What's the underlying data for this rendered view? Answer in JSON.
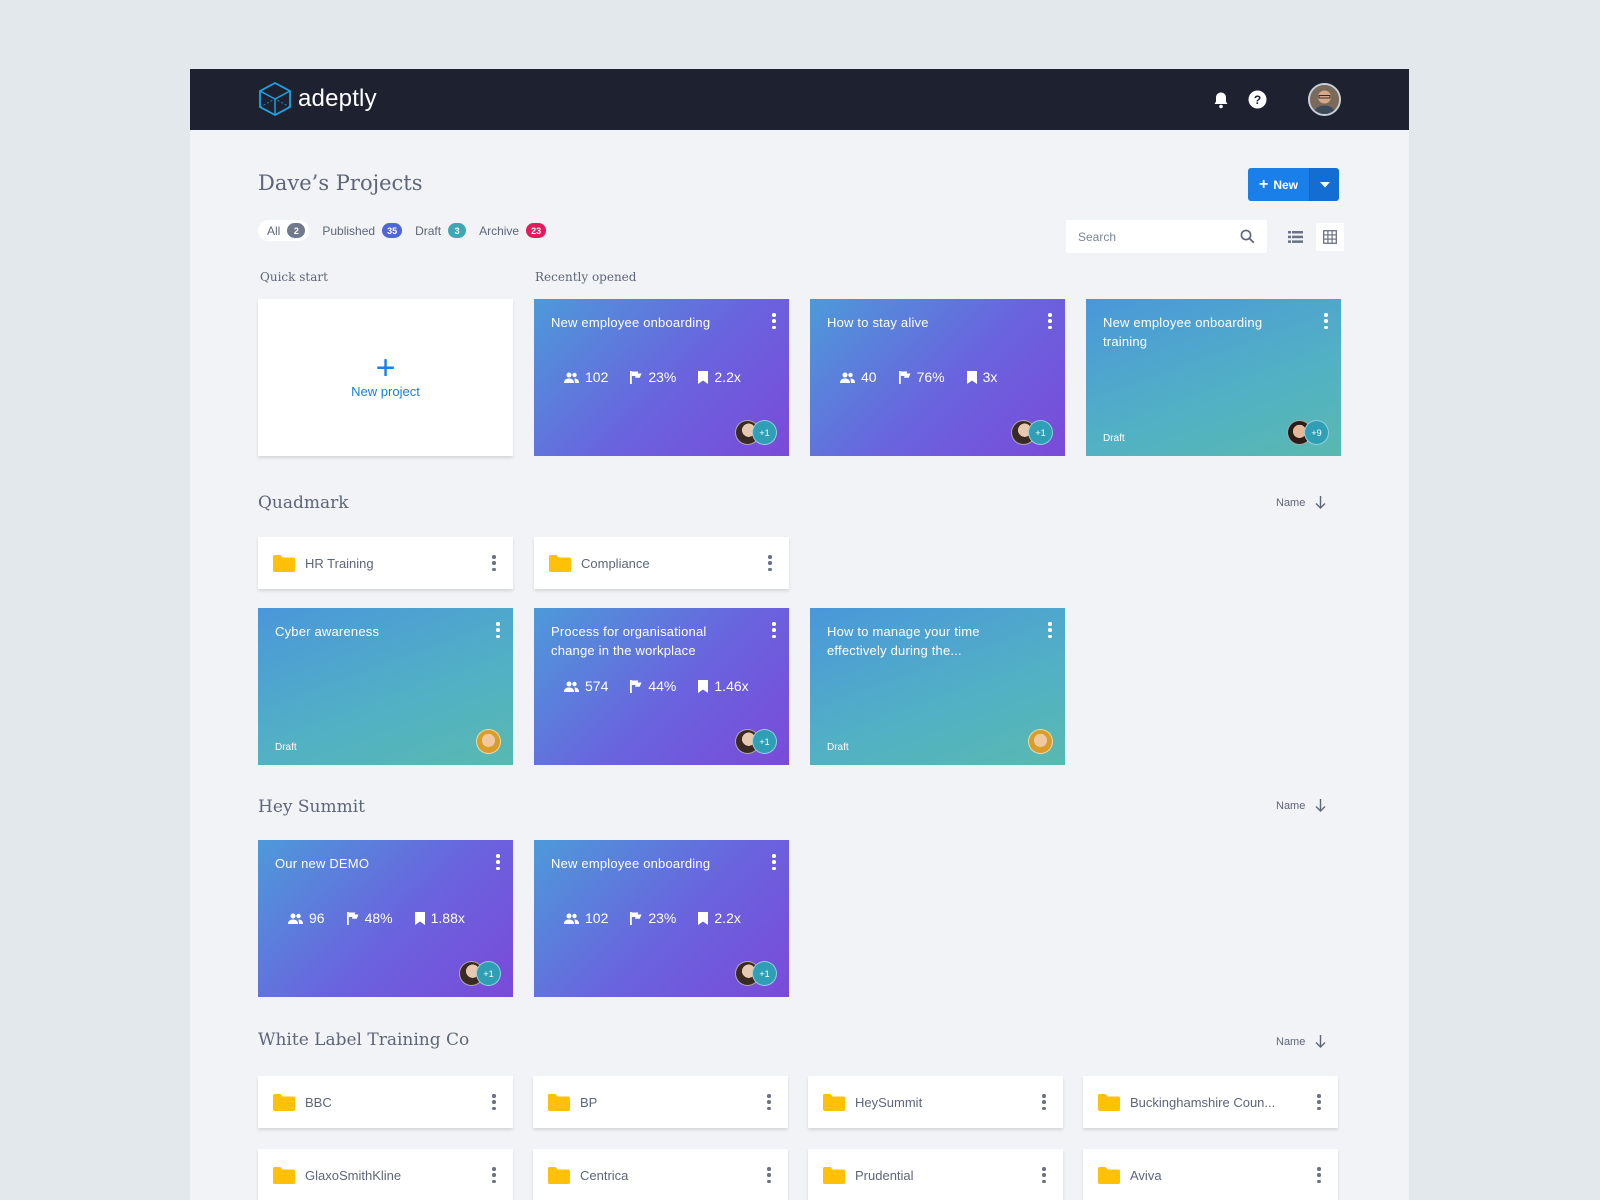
{
  "app": {
    "name": "adeptly"
  },
  "header": {
    "page_title": "Dave’s Projects",
    "new_label": "New"
  },
  "filters": [
    {
      "label": "All",
      "count": "2",
      "color": "#707a8c"
    },
    {
      "label": "Published",
      "count": "35",
      "color": "#4e66d6"
    },
    {
      "label": "Draft",
      "count": "3",
      "color": "#3fa6b6"
    },
    {
      "label": "Archive",
      "count": "23",
      "color": "#e8195a"
    }
  ],
  "search": {
    "placeholder": "Search"
  },
  "quick_start": {
    "label": "Quick start",
    "new_project": "New project"
  },
  "recent": {
    "label": "Recently opened",
    "cards": [
      {
        "title": "New employee onboarding",
        "stats": [
          "102",
          "23%",
          "2.2x"
        ],
        "more": "+1"
      },
      {
        "title": "How to stay alive",
        "stats": [
          "40",
          "76%",
          "3x"
        ],
        "more": "+1"
      },
      {
        "title": "New employee onboarding training",
        "draft": "Draft",
        "more": "+9"
      }
    ]
  },
  "quadmark": {
    "title": "Quadmark",
    "sort": "Name",
    "folders": [
      "HR Training",
      "Compliance"
    ],
    "cards": [
      {
        "title": "Cyber awareness",
        "draft": "Draft"
      },
      {
        "title": "Process for organisational change in the workplace",
        "stats": [
          "574",
          "44%",
          "1.46x"
        ],
        "more": "+1"
      },
      {
        "title": "How to manage your time effectively during the...",
        "draft": "Draft"
      }
    ]
  },
  "hey_summit": {
    "title": "Hey Summit",
    "sort": "Name",
    "cards": [
      {
        "title": "Our new DEMO",
        "stats": [
          "96",
          "48%",
          "1.88x"
        ],
        "more": "+1"
      },
      {
        "title": "New employee onboarding",
        "stats": [
          "102",
          "23%",
          "2.2x"
        ],
        "more": "+1"
      }
    ]
  },
  "white_label": {
    "title": "White Label Training Co",
    "sort": "Name",
    "folders": [
      "BBC",
      "BP",
      "HeySummit",
      "Buckinghamshire Coun...",
      "GlaxoSmithKline",
      "Centrica",
      "Prudential",
      "Aviva"
    ]
  }
}
